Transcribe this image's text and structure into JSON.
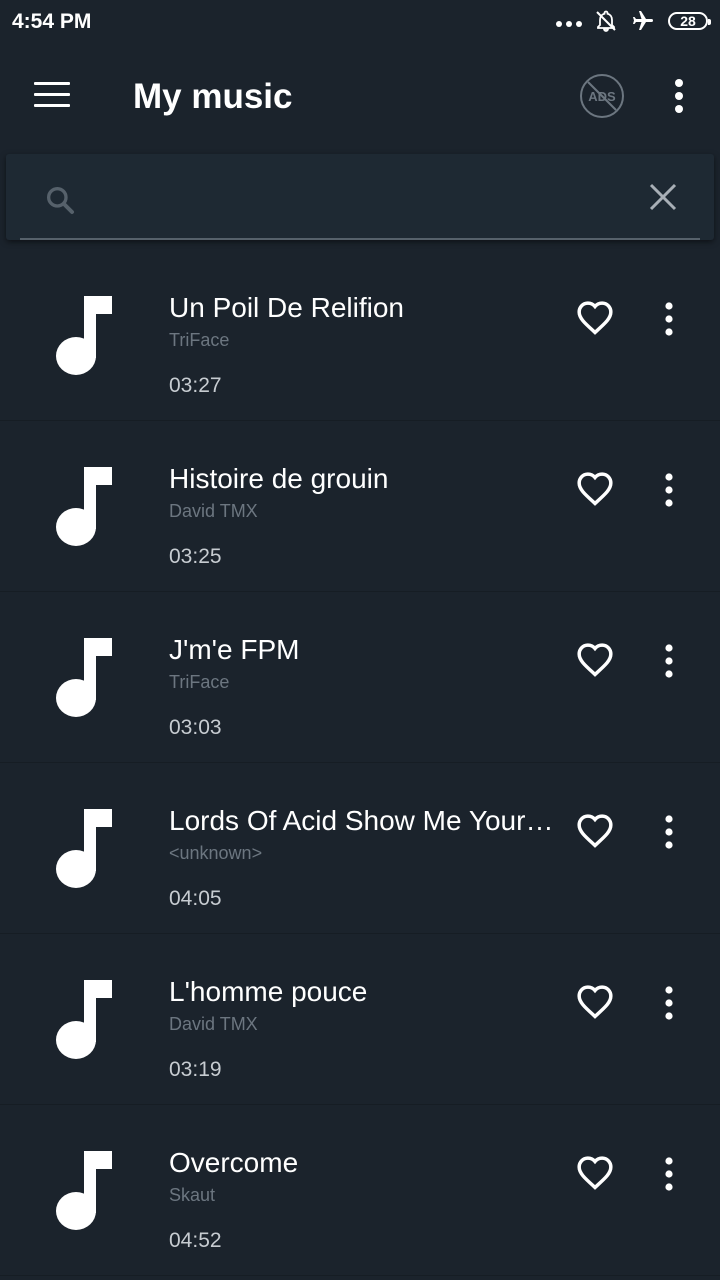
{
  "status_bar": {
    "time": "4:54 PM",
    "battery": "28",
    "icons": [
      "more-dots-icon",
      "notifications-off-icon",
      "airplane-mode-icon",
      "battery-icon"
    ]
  },
  "app_bar": {
    "title": "My music",
    "icons": [
      "menu-icon",
      "no-ads-icon",
      "more-vert-icon"
    ],
    "ads_badge_text": "ADS"
  },
  "search": {
    "value": "",
    "placeholder": "",
    "icons": [
      "search-icon",
      "close-icon"
    ]
  },
  "songs": [
    {
      "title": "Un Poil De Relifion",
      "artist": "TriFace",
      "duration": "03:27"
    },
    {
      "title": "Histoire de grouin",
      "artist": "David TMX",
      "duration": "03:25"
    },
    {
      "title": "J'm'e FPM",
      "artist": "TriFace",
      "duration": "03:03"
    },
    {
      "title": "Lords Of Acid Show Me Your Body",
      "artist": "<unknown>",
      "duration": "04:05"
    },
    {
      "title": "L'homme pouce",
      "artist": "David TMX",
      "duration": "03:19"
    },
    {
      "title": "Overcome",
      "artist": "Skaut",
      "duration": "04:52"
    }
  ],
  "colors": {
    "background": "#1b232c",
    "search_card": "#1e2933",
    "primary_text": "#ffffff",
    "secondary_text": "#6c7680",
    "duration_text": "#c7ccd1"
  }
}
